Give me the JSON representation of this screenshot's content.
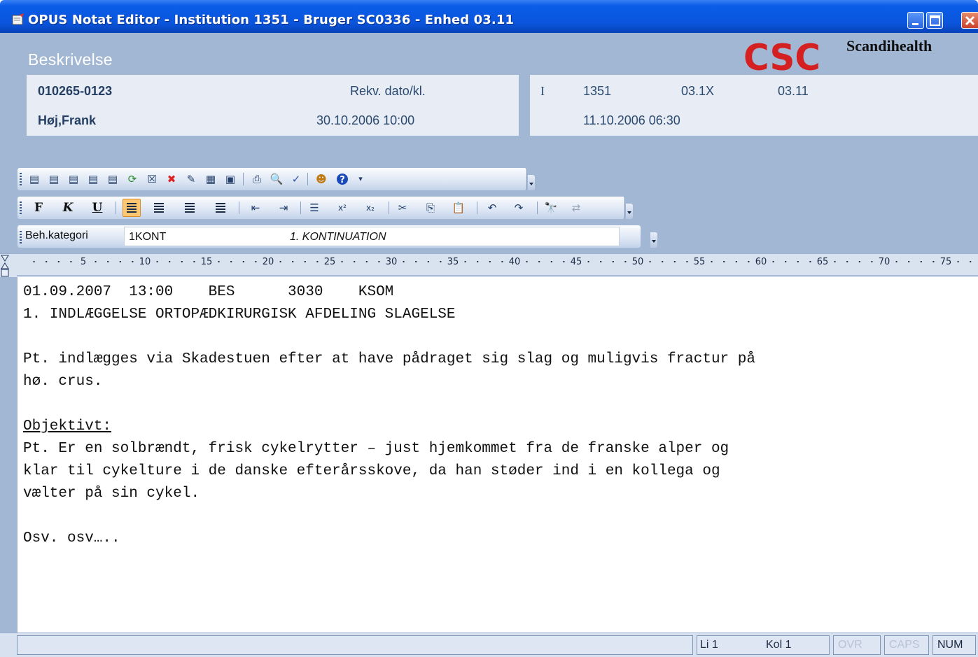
{
  "window": {
    "title": "OPUS Notat Editor - Institution 1351 - Bruger SC0336 - Enhed 03.11"
  },
  "header": {
    "section_title": "Beskrivelse",
    "logo_text": "CSC",
    "brand": "Scandihealth",
    "patient": {
      "cpr": "010265-0123",
      "name": "Høj,Frank",
      "order_date_label": "Rekv. dato/kl.",
      "order_date_value": "30.10.2006 10:00"
    },
    "order": {
      "type": "I",
      "institution": "1351",
      "unit_a": "03.1X",
      "unit_b": "03.11",
      "datetime": "11.10.2006 06:30"
    }
  },
  "toolbar_main": {
    "icons": [
      "save-icon",
      "save-close-icon",
      "save-sign-icon",
      "save-copy-icon",
      "save-print-icon",
      "refresh-icon",
      "delete-icon",
      "cancel-icon",
      "edit-icon",
      "paste-note-icon",
      "export-icon",
      "print-icon",
      "print-preview-icon",
      "spellcheck-icon",
      "users-icon",
      "help-icon"
    ]
  },
  "toolbar_format": {
    "bold_label": "F",
    "italic_label": "K",
    "underline_label": "U"
  },
  "category": {
    "label": "Beh.kategori",
    "code": "1KONT",
    "name": "1. KONTINUATION"
  },
  "ruler": {
    "marks": [
      "5",
      "10",
      "15",
      "20",
      "25",
      "30",
      "35",
      "40",
      "45",
      "50",
      "55",
      "60",
      "65",
      "70",
      "75"
    ]
  },
  "document": {
    "line1": "01.09.2007  13:00    BES      3030    KSOM",
    "line2": "1. INDLÆGGELSE ORTOPÆDKIRURGISK AFDELING SLAGELSE",
    "line3": "Pt. indlægges via Skadestuen efter at have pådraget sig slag og muligvis fractur på",
    "line4": "hø. crus.",
    "line5": "Objektivt:",
    "line6": "Pt. Er en solbrændt, frisk cykelrytter – just hjemkommet fra de franske alper og",
    "line7": "klar til cykelture i de danske efterårsskove, da han støder ind i en kollega og",
    "line8": "vælter på sin cykel.",
    "line9": "Osv. osv….."
  },
  "statusbar": {
    "line": "Li 1",
    "col": "Kol 1",
    "ovr": "OVR",
    "caps": "CAPS",
    "num": "NUM"
  }
}
